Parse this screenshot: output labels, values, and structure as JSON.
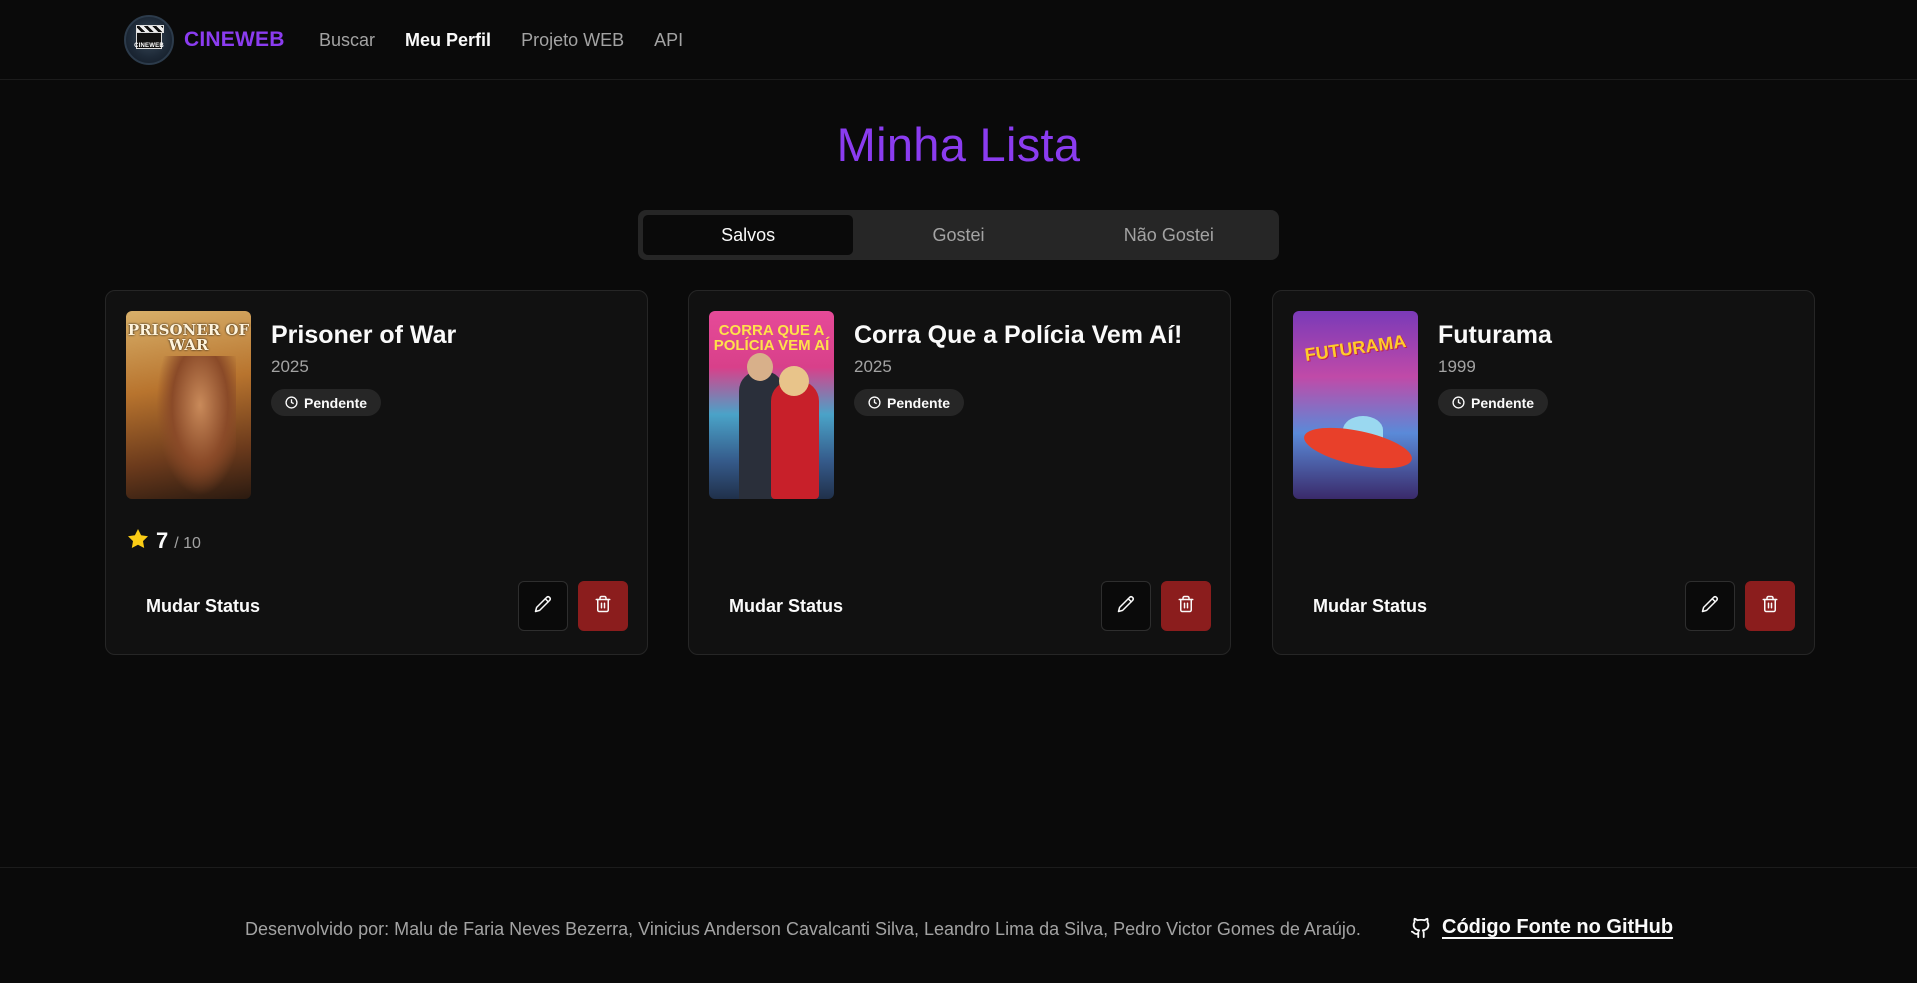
{
  "header": {
    "logo_text": "CINEWEB",
    "brand": "CINEWEB",
    "nav": [
      {
        "label": "Buscar",
        "active": false
      },
      {
        "label": "Meu Perfil",
        "active": true
      },
      {
        "label": "Projeto WEB",
        "active": false
      },
      {
        "label": "API",
        "active": false
      }
    ]
  },
  "page_title": "Minha Lista",
  "tabs": [
    {
      "label": "Salvos",
      "active": true
    },
    {
      "label": "Gostei",
      "active": false
    },
    {
      "label": "Não Gostei",
      "active": false
    }
  ],
  "cards": [
    {
      "poster_text": "PRISONER OF WAR",
      "title": "Prisoner of War",
      "year": "2025",
      "status": "Pendente",
      "rating": {
        "value": "7",
        "max": "/ 10"
      },
      "status_button": "Mudar Status"
    },
    {
      "poster_text": "CORRA QUE A POLÍCIA VEM AÍ",
      "title": "Corra Que a Polícia Vem Aí!",
      "year": "2025",
      "status": "Pendente",
      "status_button": "Mudar Status"
    },
    {
      "poster_text": "FUTURAMA",
      "title": "Futurama",
      "year": "1999",
      "status": "Pendente",
      "status_button": "Mudar Status"
    }
  ],
  "footer": {
    "credits": "Desenvolvido por: Malu de Faria Neves Bezerra, Vinicius Anderson Cavalcanti Silva, Leandro Lima da Silva, Pedro Victor Gomes de Araújo.",
    "github_label": "Código Fonte no GitHub"
  },
  "colors": {
    "background": "#0a0a0a",
    "accent": "#8b3cf0",
    "danger": "#8b1d1d",
    "star": "#facc15"
  },
  "icons": [
    "clapperboard-logo",
    "clock-icon",
    "star-icon",
    "pencil-icon",
    "trash-icon",
    "github-icon"
  ]
}
